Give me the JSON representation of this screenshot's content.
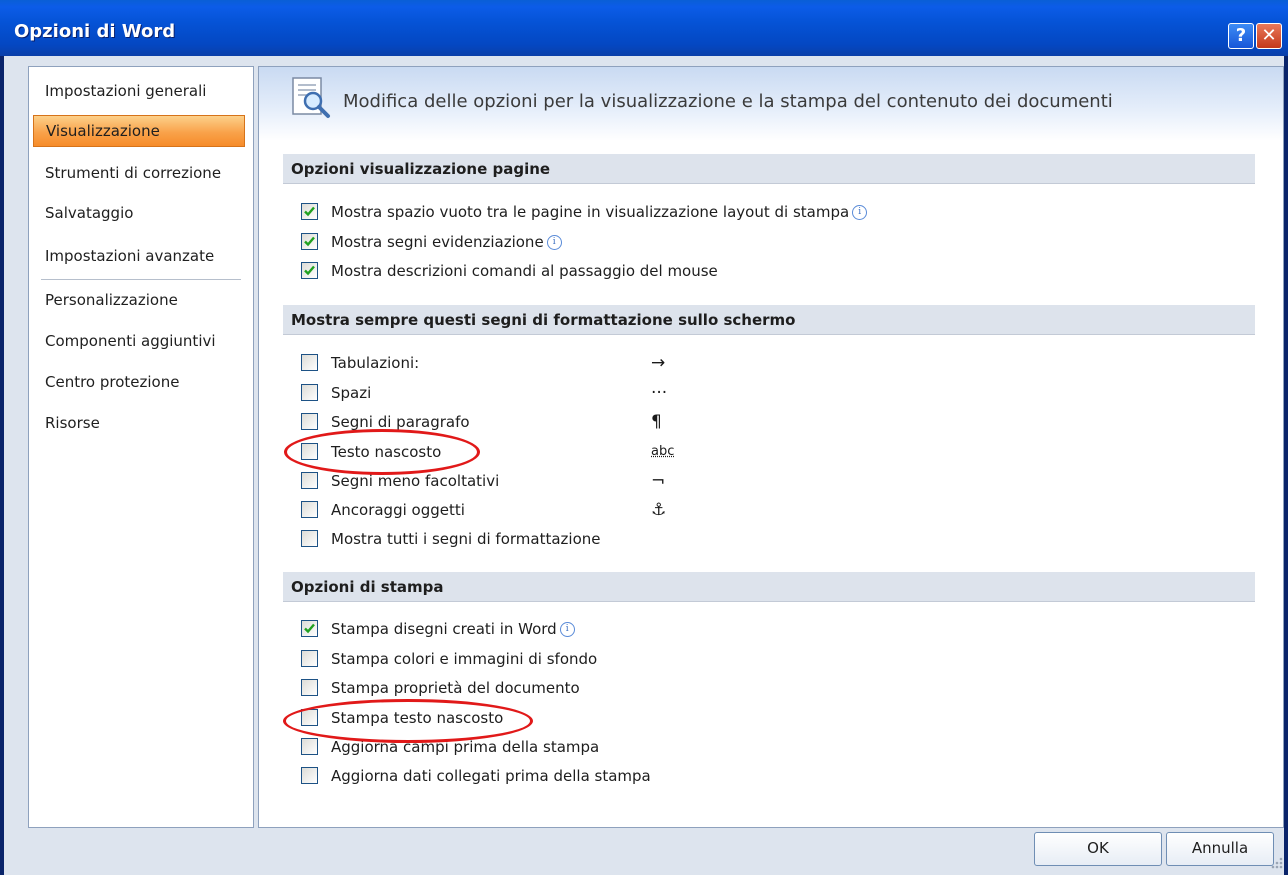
{
  "window": {
    "title": "Opzioni di Word",
    "help_label": "?",
    "close_label": "✕"
  },
  "sidebar": {
    "items": [
      {
        "label": "Impostazioni generali",
        "selected": false
      },
      {
        "label": "Visualizzazione",
        "selected": true
      },
      {
        "label": "Strumenti di correzione",
        "selected": false
      },
      {
        "label": "Salvataggio",
        "selected": false
      },
      {
        "label": "Impostazioni avanzate",
        "selected": false
      },
      {
        "label": "Personalizzazione",
        "selected": false
      },
      {
        "label": "Componenti aggiuntivi",
        "selected": false
      },
      {
        "label": "Centro protezione",
        "selected": false
      },
      {
        "label": "Risorse",
        "selected": false
      }
    ]
  },
  "main": {
    "heading": "Modifica delle opzioni per la visualizzazione e la stampa del contenuto dei documenti",
    "sections": [
      {
        "title": "Opzioni visualizzazione pagine",
        "options": [
          {
            "label": "Mostra spazio vuoto tra le pagine in visualizzazione layout di stampa",
            "checked": true,
            "info": true
          },
          {
            "label": "Mostra segni evidenziazione",
            "checked": true,
            "info": true
          },
          {
            "label": "Mostra descrizioni comandi al passaggio del mouse",
            "checked": true,
            "info": false
          }
        ]
      },
      {
        "title": "Mostra sempre questi segni di formattazione sullo schermo",
        "options": [
          {
            "label": "Tabulazioni:",
            "checked": false,
            "symbol": "→"
          },
          {
            "label": "Spazi",
            "checked": false,
            "symbol": "···"
          },
          {
            "label": "Segni di paragrafo",
            "checked": false,
            "symbol": "¶"
          },
          {
            "label": "Testo nascosto",
            "checked": false,
            "symbol": "abc"
          },
          {
            "label": "Segni meno facoltativi",
            "checked": false,
            "symbol": "¬"
          },
          {
            "label": "Ancoraggi oggetti",
            "checked": false,
            "symbol": "⚓"
          },
          {
            "label": "Mostra tutti i segni di formattazione",
            "checked": false
          }
        ]
      },
      {
        "title": "Opzioni di stampa",
        "options": [
          {
            "label": "Stampa disegni creati in Word",
            "checked": true,
            "info": true
          },
          {
            "label": "Stampa colori e immagini di sfondo",
            "checked": false
          },
          {
            "label": "Stampa proprietà del documento",
            "checked": false
          },
          {
            "label": "Stampa testo nascosto",
            "checked": false
          },
          {
            "label": "Aggiorna campi prima della stampa",
            "checked": false
          },
          {
            "label": "Aggiorna dati collegati prima della stampa",
            "checked": false
          }
        ]
      }
    ]
  },
  "footer": {
    "ok_label": "OK",
    "cancel_label": "Annulla"
  },
  "colors": {
    "title_bar": "#0553d6",
    "selected_nav": "#f9a24a",
    "highlight_ellipse": "#e11919",
    "checkbox_check": "#21a121"
  }
}
